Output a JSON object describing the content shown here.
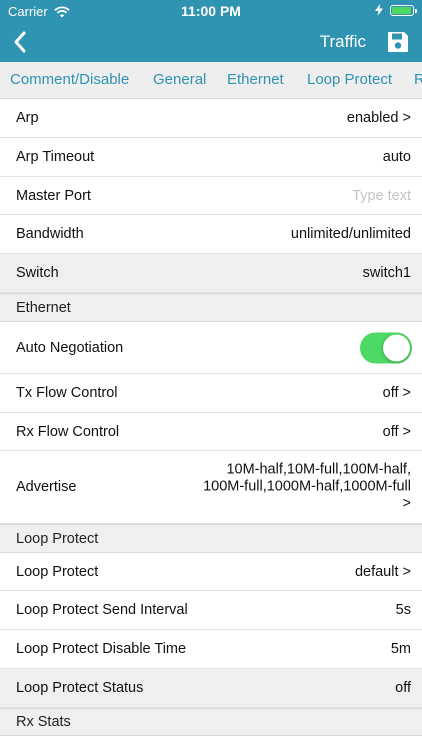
{
  "status_bar": {
    "carrier": "Carrier",
    "time": "11:00 PM",
    "battery_color": "#4cd964"
  },
  "nav": {
    "title": "Traffic",
    "back_icon": "chevron-left-icon",
    "save_icon": "floppy-disk-icon"
  },
  "tabs": [
    "Comment/Disable",
    "General",
    "Ethernet",
    "Loop Protect",
    "R"
  ],
  "rows": {
    "arp": {
      "label": "Arp",
      "value": "enabled >"
    },
    "arp_timeout": {
      "label": "Arp Timeout",
      "value": "auto"
    },
    "master_port": {
      "label": "Master Port",
      "placeholder": "Type text"
    },
    "bandwidth": {
      "label": "Bandwidth",
      "value": "unlimited/unlimited"
    },
    "switch": {
      "label": "Switch",
      "value": "switch1"
    },
    "ethernet_section": "Ethernet",
    "auto_negotiation": {
      "label": "Auto Negotiation",
      "enabled": true
    },
    "tx_flow": {
      "label": "Tx Flow Control",
      "value": "off >"
    },
    "rx_flow": {
      "label": "Rx Flow Control",
      "value": "off >"
    },
    "advertise": {
      "label": "Advertise",
      "value": "10M-half,10M-full,100M-half, 100M-full,1000M-half,1000M-full >"
    },
    "loop_section": "Loop Protect",
    "loop_protect": {
      "label": "Loop Protect",
      "value": "default >"
    },
    "loop_interval": {
      "label": "Loop Protect Send Interval",
      "value": "5s"
    },
    "loop_disable": {
      "label": "Loop Protect Disable Time",
      "value": "5m"
    },
    "loop_status": {
      "label": "Loop Protect Status",
      "value": "off"
    },
    "rx_stats_section": "Rx Stats"
  },
  "colors": {
    "accent": "#2f93b2",
    "toggle_on": "#4cd964"
  }
}
